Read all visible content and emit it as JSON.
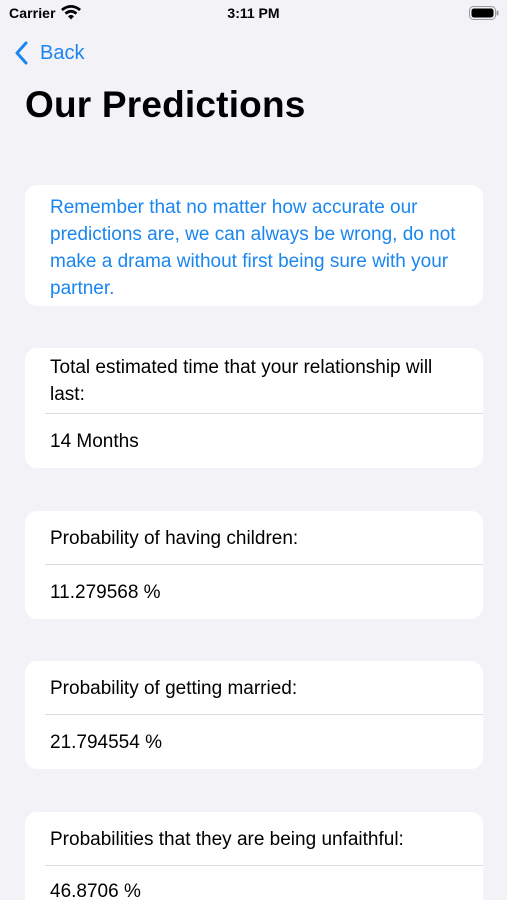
{
  "status_bar": {
    "carrier": "Carrier",
    "time": "3:11 PM",
    "wifi_icon": "wifi-icon",
    "battery_icon": "battery-icon"
  },
  "nav": {
    "back_label": "Back",
    "back_icon": "chevron-left-icon"
  },
  "page_title": "Our Predictions",
  "notice": {
    "text": "Remember that no matter how accurate our predictions are, we can always be wrong, do not make a drama without first being sure with your partner."
  },
  "predictions": [
    {
      "label": "Total estimated time that your relationship will last:",
      "value": "14 Months"
    },
    {
      "label": "Probability of having children:",
      "value": "11.279568 %"
    },
    {
      "label": "Probability of getting married:",
      "value": "21.794554 %"
    },
    {
      "label": "Probabilities that they are being unfaithful:",
      "value": "46.8706 %"
    }
  ],
  "colors": {
    "background": "#f2f2f7",
    "card": "#ffffff",
    "accent": "#1a86f0",
    "text": "#000000"
  }
}
